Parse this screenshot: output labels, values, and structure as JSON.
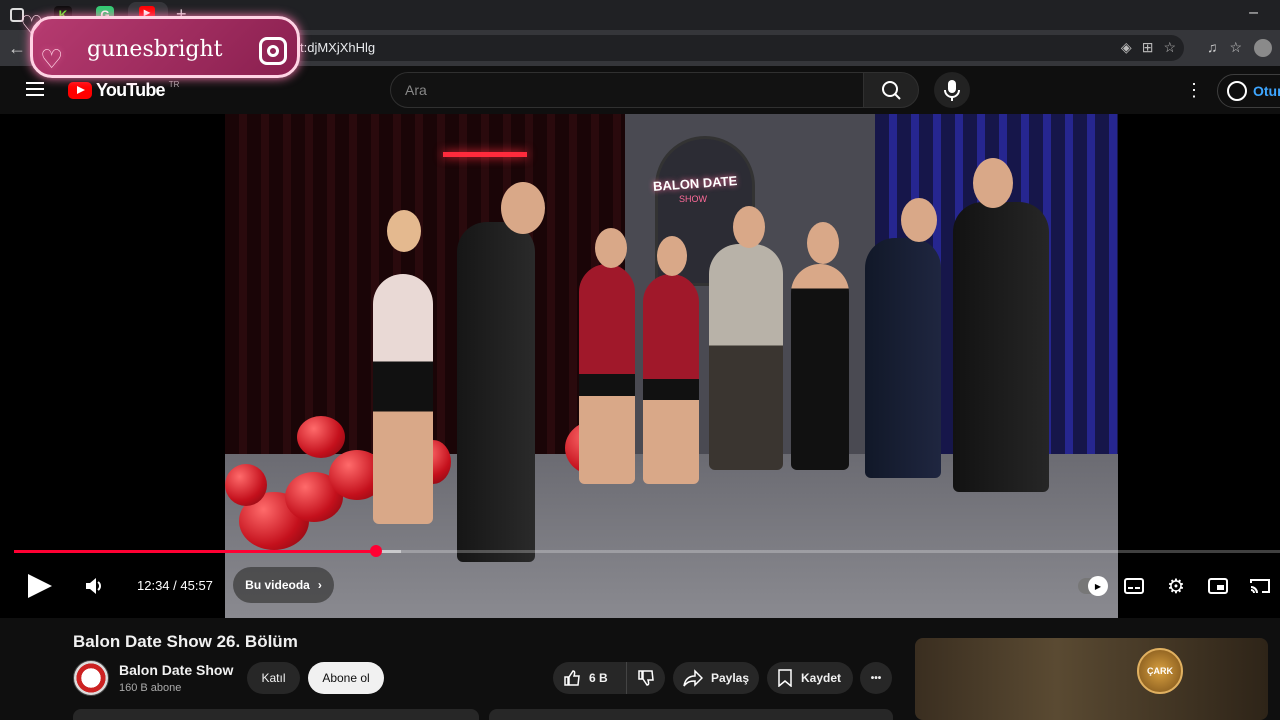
{
  "browser": {
    "url_fragment": "t:djMXjXhHlg",
    "tabs": [
      {
        "icon": "kick-tab-icon",
        "letter": "K",
        "color": "#53fc18"
      },
      {
        "icon": "app-tab-icon",
        "letter": "G",
        "color": "#2ecc71"
      },
      {
        "icon": "youtube-tab-icon",
        "letter": "▶",
        "color": "#ff0000"
      }
    ],
    "new_tab": "+",
    "minimize": "–"
  },
  "watermark": {
    "handle": "gunesbright"
  },
  "header": {
    "logo_text": "YouTube",
    "logo_superscript": "TR",
    "search_placeholder": "Ara",
    "signin_label": "Otur"
  },
  "player": {
    "current_time": "12:34",
    "duration": "45:57",
    "time_display": "12:34 / 45:57",
    "chapter_label": "Bu videoda",
    "progress": 0.286,
    "buffered": 0.306,
    "video_scene": {
      "neon_sign": "BALON DATE",
      "neon_sub": "SHOW"
    }
  },
  "video": {
    "title": "Balon Date Show 26. Bölüm",
    "channel": "Balon Date Show",
    "subscribers": "160 B abone",
    "join_label": "Katıl",
    "subscribe_label": "Abone ol",
    "likes": "6 B",
    "share_label": "Paylaş",
    "save_label": "Kaydet",
    "more_label": "•••"
  },
  "ad": {
    "logo_text": "ÇARK"
  },
  "colors": {
    "accent": "#ff0033",
    "background": "#0f0f0f",
    "link": "#3ea6ff"
  }
}
